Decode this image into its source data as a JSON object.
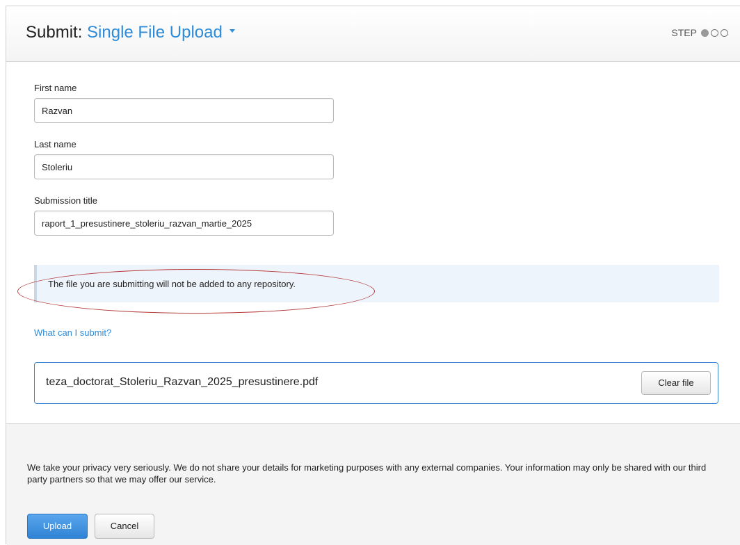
{
  "header": {
    "prefix": "Submit:",
    "mode": "Single File Upload",
    "step_label": "STEP",
    "step_current": 1,
    "step_total": 3
  },
  "form": {
    "first_name": {
      "label": "First name",
      "value": "Razvan"
    },
    "last_name": {
      "label": "Last name",
      "value": "Stoleriu"
    },
    "title": {
      "label": "Submission title",
      "value": "raport_1_presustinere_stoleriu_razvan_martie_2025"
    }
  },
  "notice": {
    "text": "The file you are submitting will not be added to any repository."
  },
  "help_link": "What can I submit?",
  "file": {
    "name": "teza_doctorat_Stoleriu_Razvan_2025_presustinere.pdf",
    "clear_label": "Clear file"
  },
  "footer": {
    "privacy_text": "We take your privacy very seriously. We do not share your details for marketing purposes with any external companies. Your information may only be shared with our third party partners so that we may offer our service.",
    "upload_label": "Upload",
    "cancel_label": "Cancel"
  },
  "colors": {
    "accent": "#2e8bd8",
    "annotation": "#b23a3a",
    "notice_bg": "#eef4fb"
  }
}
